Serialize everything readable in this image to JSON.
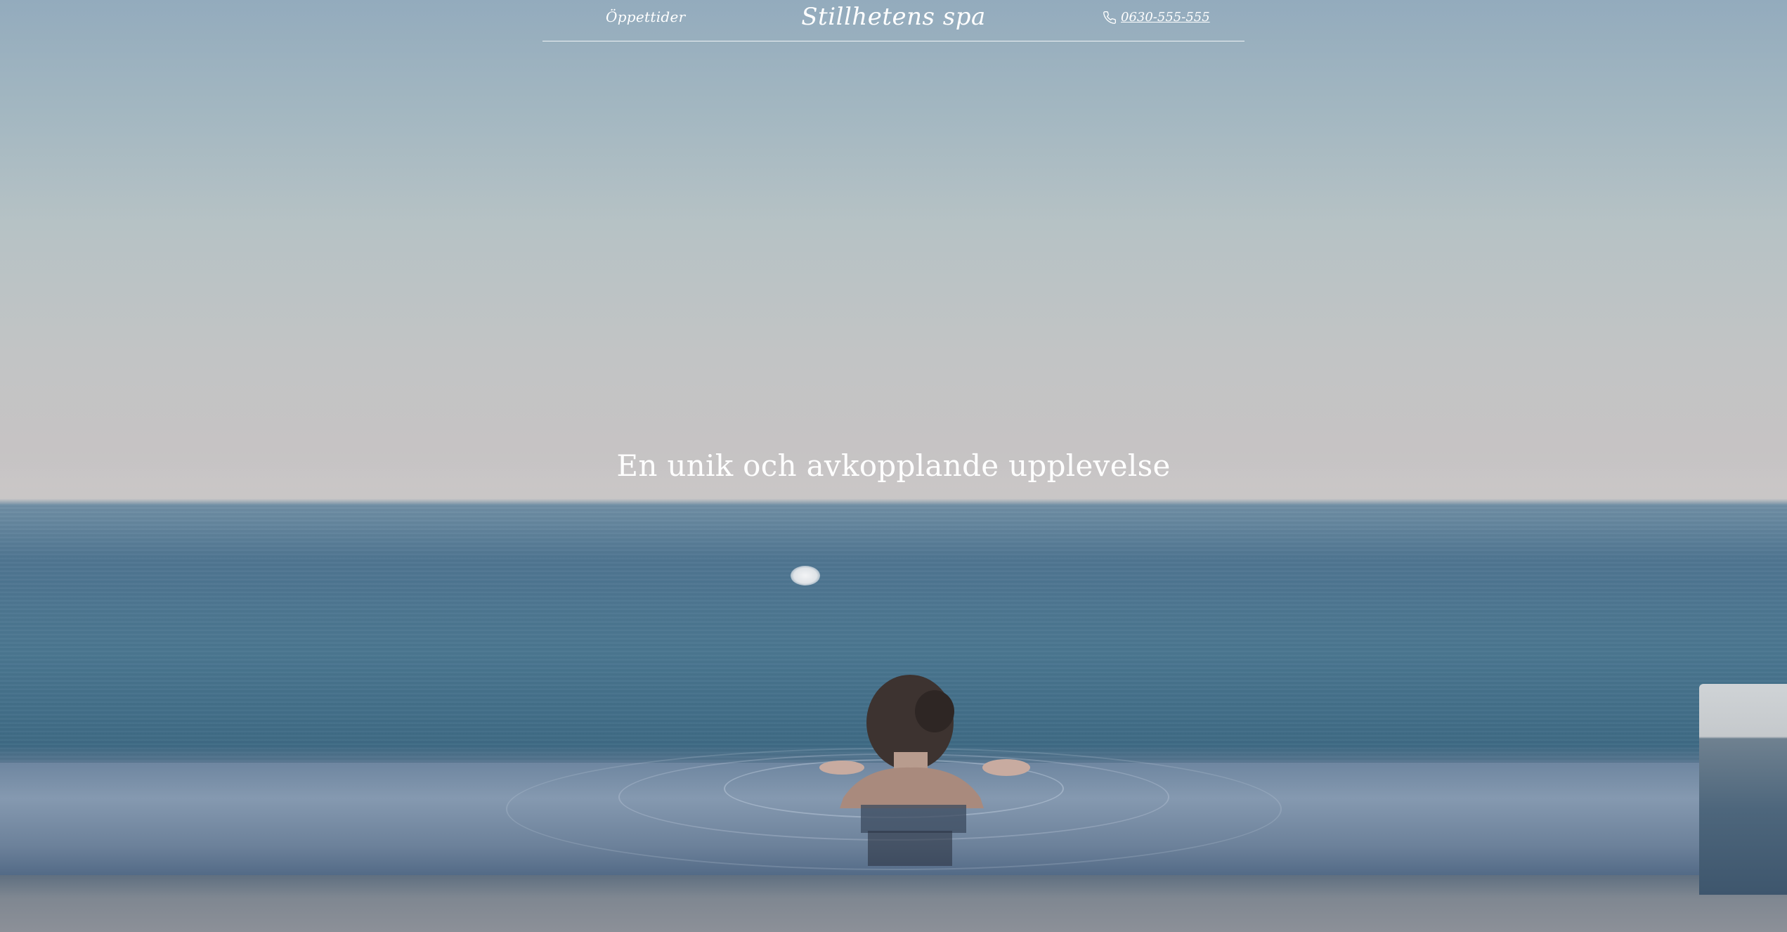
{
  "header": {
    "nav_link": "Öppettider",
    "logo": "Stillhetens spa",
    "phone": "0630-555-555"
  },
  "hero": {
    "title": "En unik och avkopplande upplevelse"
  },
  "icons": {
    "phone": "phone-icon"
  }
}
